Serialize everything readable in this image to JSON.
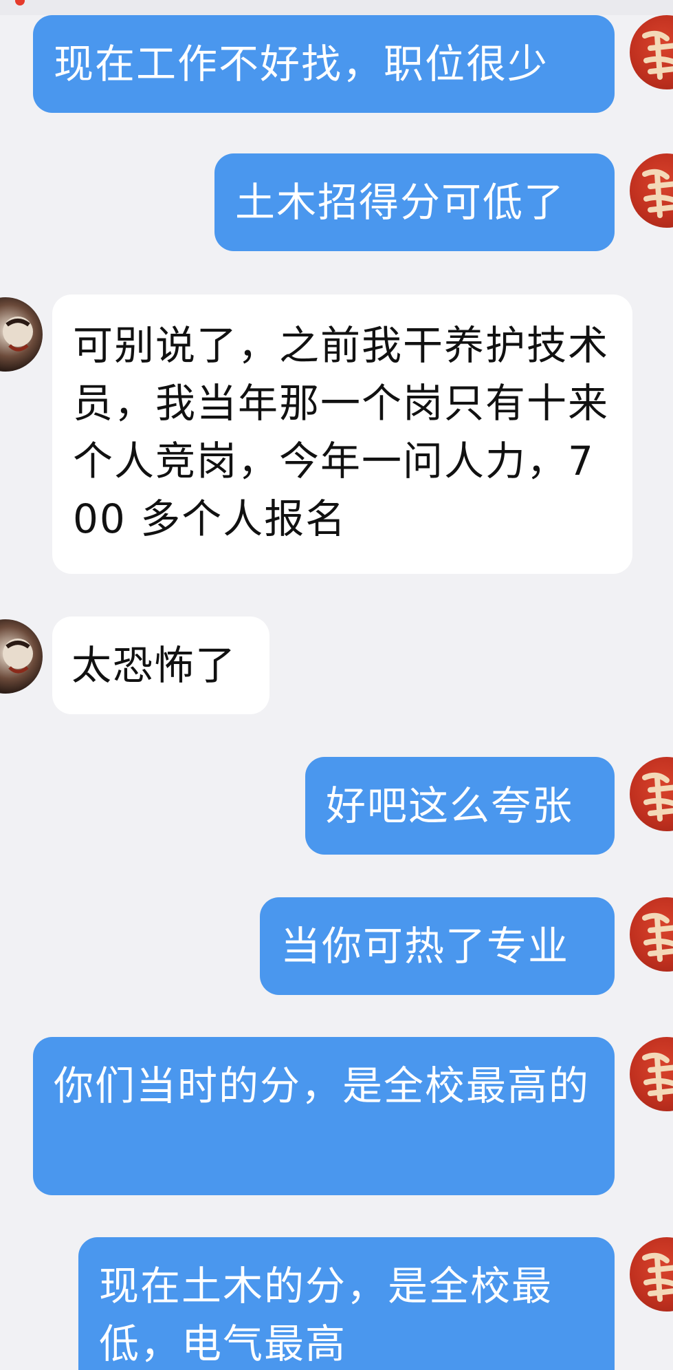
{
  "messages": [
    {
      "side": "me",
      "text": "现在工作不好找，职位很少"
    },
    {
      "side": "me",
      "text": "土木招得分可低了"
    },
    {
      "side": "them",
      "text": "可别说了，之前我干养护技术员，我当年那一个岗只有十来个人竞岗，今年一问人力，700 多个人报名"
    },
    {
      "side": "them",
      "text": "太恐怖了"
    },
    {
      "side": "me",
      "text": "好吧这么夸张"
    },
    {
      "side": "me",
      "text": "当你可热了专业"
    },
    {
      "side": "me",
      "text": "你们当时的分，是全校最高的"
    },
    {
      "side": "me",
      "text": "现在土木的分，是全校最低，电气最高"
    }
  ],
  "avatars": {
    "me": {
      "icon": "red-calligraphy-avatar-icon",
      "color": "#c93423"
    },
    "them": {
      "icon": "portrait-avatar-icon",
      "color": "#3a2a22"
    }
  },
  "colors": {
    "background": "#f1f1f4",
    "my_bubble": "#4a97ee",
    "their_bubble": "#ffffff"
  }
}
